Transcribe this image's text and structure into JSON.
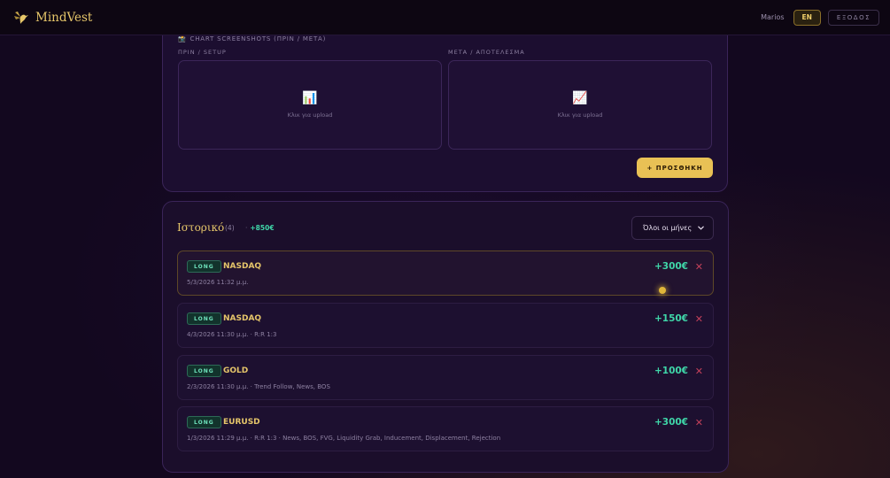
{
  "app": {
    "name": "MindVest",
    "user": "Marios",
    "lang_label": "EN",
    "logout_label": "ΕΞΟΔΟΣ"
  },
  "screenshots": {
    "section_title": "CHART SCREENSHOTS (ΠΡΙΝ / ΜΕΤΑ)",
    "before_label": "ΠΡΙΝ / SETUP",
    "after_label": "ΜΕΤΑ / ΑΠΟΤΕΛΕΣΜΑ",
    "before_icon": "📊",
    "after_icon": "📈",
    "upload_text": "Κλικ για upload",
    "add_button": "+ ΠΡΟΣΘΗΚΗ"
  },
  "history": {
    "title": "Ιστορικό",
    "count": "(4)",
    "total": "+850€",
    "filter_value": "Όλοι οι μήνες",
    "trades": [
      {
        "direction": "LONG",
        "symbol": "NASDAQ",
        "meta": "5/3/2026 11:32 μ.μ.",
        "pnl": "+300€",
        "delete": "✕"
      },
      {
        "direction": "LONG",
        "symbol": "NASDAQ",
        "meta": "4/3/2026 11:30 μ.μ. · R:R 1:3",
        "pnl": "+150€",
        "delete": "✕"
      },
      {
        "direction": "LONG",
        "symbol": "GOLD",
        "meta": "2/3/2026 11:30 μ.μ. · Trend Follow, News, BOS",
        "pnl": "+100€",
        "delete": "✕"
      },
      {
        "direction": "LONG",
        "symbol": "EURUSD",
        "meta": "1/3/2026 11:29 μ.μ. · R:R 1:3 · News, BOS, FVG, Liquidity Grab, Inducement, Displacement, Rejection",
        "pnl": "+300€",
        "delete": "✕"
      }
    ]
  },
  "colors": {
    "accent_gold": "#e6c66a",
    "profit_green": "#3fd6a8",
    "delete_red": "#c2405a",
    "background": "#13081f"
  }
}
